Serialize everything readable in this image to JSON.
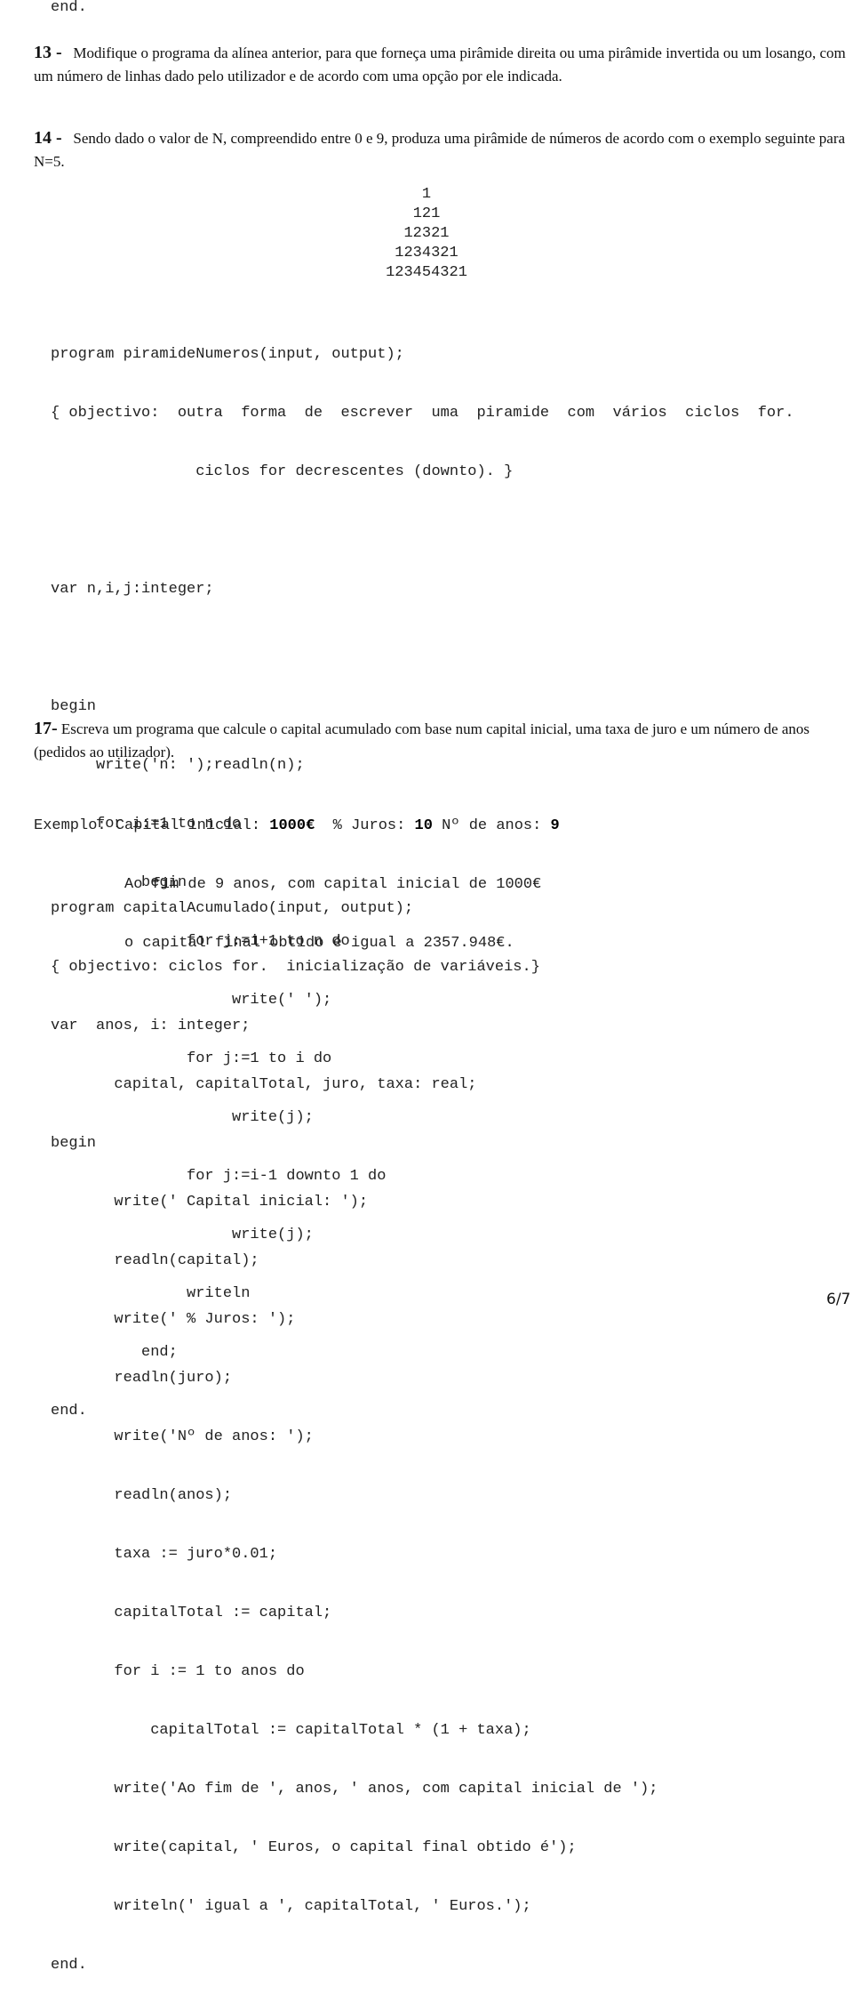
{
  "top_end": "end.",
  "q13": {
    "number": "13 -",
    "text": "Modifique o programa da alínea anterior, para que forneça uma pirâmide direita ou uma pirâmide invertida ou um losango, com um número de linhas dado pelo utilizador e de acordo com uma opção por ele indicada."
  },
  "q14": {
    "number": "14 -",
    "text": "Sendo dado o valor de N, compreendido entre 0 e 9, produza uma pirâmide de números de acordo com o exemplo seguinte para N=5.",
    "pyramid": [
      "1",
      "121",
      "12321",
      "1234321",
      "123454321"
    ],
    "code": [
      "program piramideNumeros(input, output);",
      "{ objectivo:  outra  forma  de  escrever  uma  piramide  com  vários  ciclos  for.",
      "                ciclos for decrescentes (downto). }",
      "",
      "var n,i,j:integer;",
      "",
      "begin",
      "     write('n: ');readln(n);",
      "     for i:=1 to n do",
      "          begin",
      "               for j:=i+1 to n do",
      "                    write(' ');",
      "               for j:=1 to i do",
      "                    write(j);",
      "               for j:=i-1 downto 1 do",
      "                    write(j);",
      "               writeln",
      "          end;",
      "end."
    ]
  },
  "q17": {
    "number": "17-",
    "text": "Escreva um programa que calcule o capital acumulado com base num capital inicial, uma taxa de juro e um número de anos (pedidos ao utilizador).",
    "example": {
      "label": "Exemplo: ",
      "line1_a": "Capital inicial: ",
      "capital": "1000€",
      "line1_b": "  % Juros: ",
      "juros": "10",
      "line1_c": " Nº de anos: ",
      "anos": "9",
      "line2": "Ao fim de 9 anos, com capital inicial de 1000€",
      "line3": "o capital final obtido é igual a 2357.948€."
    },
    "code": [
      "program capitalAcumulado(input, output);",
      "{ objectivo: ciclos for.  inicialização de variáveis.}",
      "var  anos, i: integer;",
      "       capital, capitalTotal, juro, taxa: real;",
      "begin",
      "       write(' Capital inicial: ');",
      "       readln(capital);",
      "       write(' % Juros: ');",
      "       readln(juro);",
      "       write('Nº de anos: ');",
      "       readln(anos);",
      "       taxa := juro*0.01;",
      "       capitalTotal := capital;",
      "       for i := 1 to anos do",
      "           capitalTotal := capitalTotal * (1 + taxa);",
      "       write('Ao fim de ', anos, ' anos, com capital inicial de ');",
      "       write(capital, ' Euros, o capital final obtido é');",
      "       writeln(' igual a ', capitalTotal, ' Euros.');",
      "end."
    ]
  },
  "page_number": "6/7"
}
